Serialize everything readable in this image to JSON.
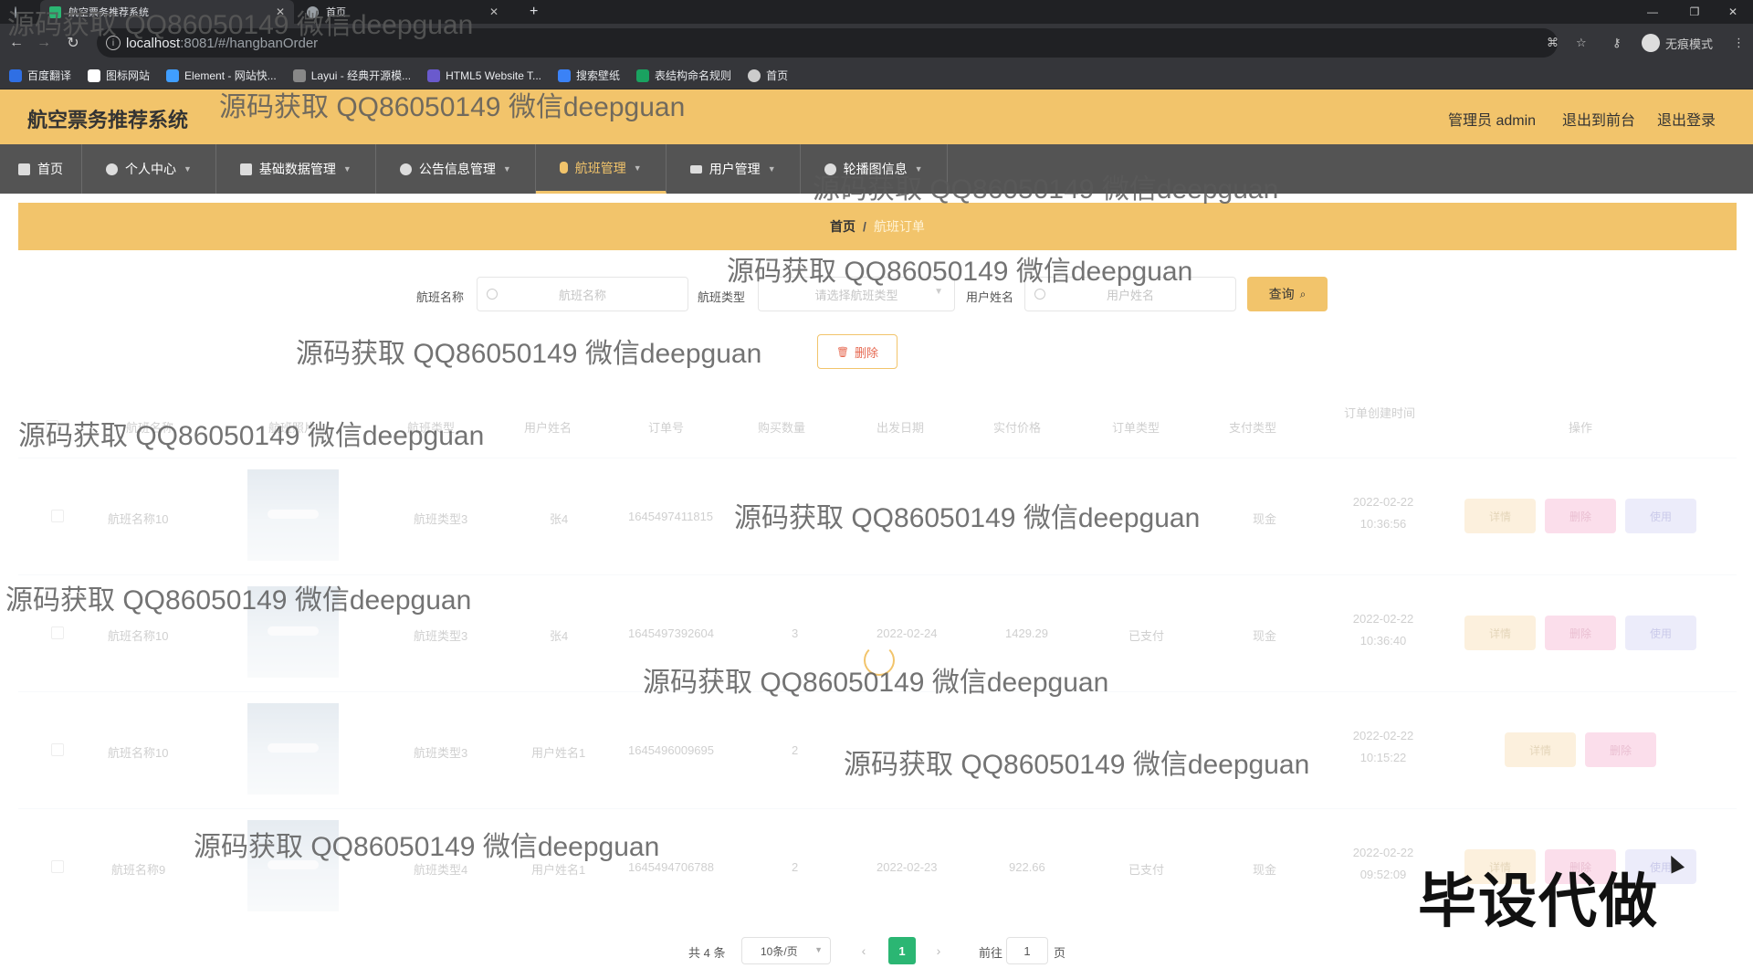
{
  "browser": {
    "tabs": [
      {
        "label": "航空票务推荐系统",
        "active": true
      },
      {
        "label": "首页",
        "active": false
      }
    ],
    "new_tab": "+",
    "url_host": "localhost",
    "url_rest": ":8081/#/hangbanOrder",
    "incognito": "无痕模式",
    "bookmarks": [
      "百度翻译",
      "图标网站",
      "Element - 网站快...",
      "Layui - 经典开源模...",
      "HTML5 Website T...",
      "搜索壁纸",
      "表结构命名规则",
      "首页"
    ]
  },
  "header": {
    "title": "航空票务推荐系统",
    "admin": "管理员 admin",
    "back_front": "退出到前台",
    "logout": "退出登录"
  },
  "menu": [
    {
      "label": "首页",
      "active": false
    },
    {
      "label": "个人中心",
      "active": false
    },
    {
      "label": "基础数据管理",
      "active": false
    },
    {
      "label": "公告信息管理",
      "active": false
    },
    {
      "label": "航班管理",
      "active": true
    },
    {
      "label": "用户管理",
      "active": false
    },
    {
      "label": "轮播图信息",
      "active": false
    }
  ],
  "breadcrumb": {
    "home": "首页",
    "sep": "/",
    "current": "航班订单"
  },
  "search": {
    "flight_name_label": "航班名称",
    "flight_name_placeholder": "航班名称",
    "flight_type_label": "航班类型",
    "flight_type_placeholder": "请选择航班类型",
    "user_name_label": "用户姓名",
    "user_name_placeholder": "用户姓名",
    "query_button": "查询"
  },
  "delete_button": "删除",
  "table": {
    "headers": [
      "航班名称",
      "航班照片",
      "航班类型",
      "用户姓名",
      "订单号",
      "购买数量",
      "出发日期",
      "实付价格",
      "订单类型",
      "支付类型",
      "订单创建时间",
      "操作"
    ],
    "rows": [
      {
        "name": "航班名称10",
        "type": "航班类型3",
        "user": "张4",
        "order_no": "1645497411815",
        "qty": "",
        "date": "",
        "price": "",
        "status": "",
        "pay": "现金",
        "time": "2022-02-22 10:36:56",
        "actions": [
          "详情",
          "删除",
          "使用"
        ]
      },
      {
        "name": "航班名称10",
        "type": "航班类型3",
        "user": "张4",
        "order_no": "1645497392604",
        "qty": "3",
        "date": "2022-02-24",
        "price": "1429.29",
        "status": "已支付",
        "pay": "现金",
        "time": "2022-02-22 10:36:40",
        "actions": [
          "详情",
          "删除",
          "使用"
        ]
      },
      {
        "name": "航班名称10",
        "type": "航班类型3",
        "user": "用户姓名1",
        "order_no": "1645496009695",
        "qty": "2",
        "date": "",
        "price": "",
        "status": "",
        "pay": "",
        "time": "2022-02-22 10:15:22",
        "actions": [
          "详情",
          "删除"
        ]
      },
      {
        "name": "航班名称9",
        "type": "航班类型4",
        "user": "用户姓名1",
        "order_no": "1645494706788",
        "qty": "2",
        "date": "2022-02-23",
        "price": "922.66",
        "status": "已支付",
        "pay": "现金",
        "time": "2022-02-22 09:52:09",
        "actions": [
          "详情",
          "删除",
          "使用"
        ]
      }
    ]
  },
  "pagination": {
    "total": "共 4 条",
    "page_size": "10条/页",
    "current": "1",
    "goto": "前往",
    "goto_value": "1",
    "unit": "页"
  },
  "watermarks": {
    "text": "源码获取 QQ86050149 微信deepguan",
    "big": "毕设代做"
  },
  "colors": {
    "accent": "#f2c46b",
    "menu_bg": "#545454",
    "pager_active": "#2bb673"
  }
}
